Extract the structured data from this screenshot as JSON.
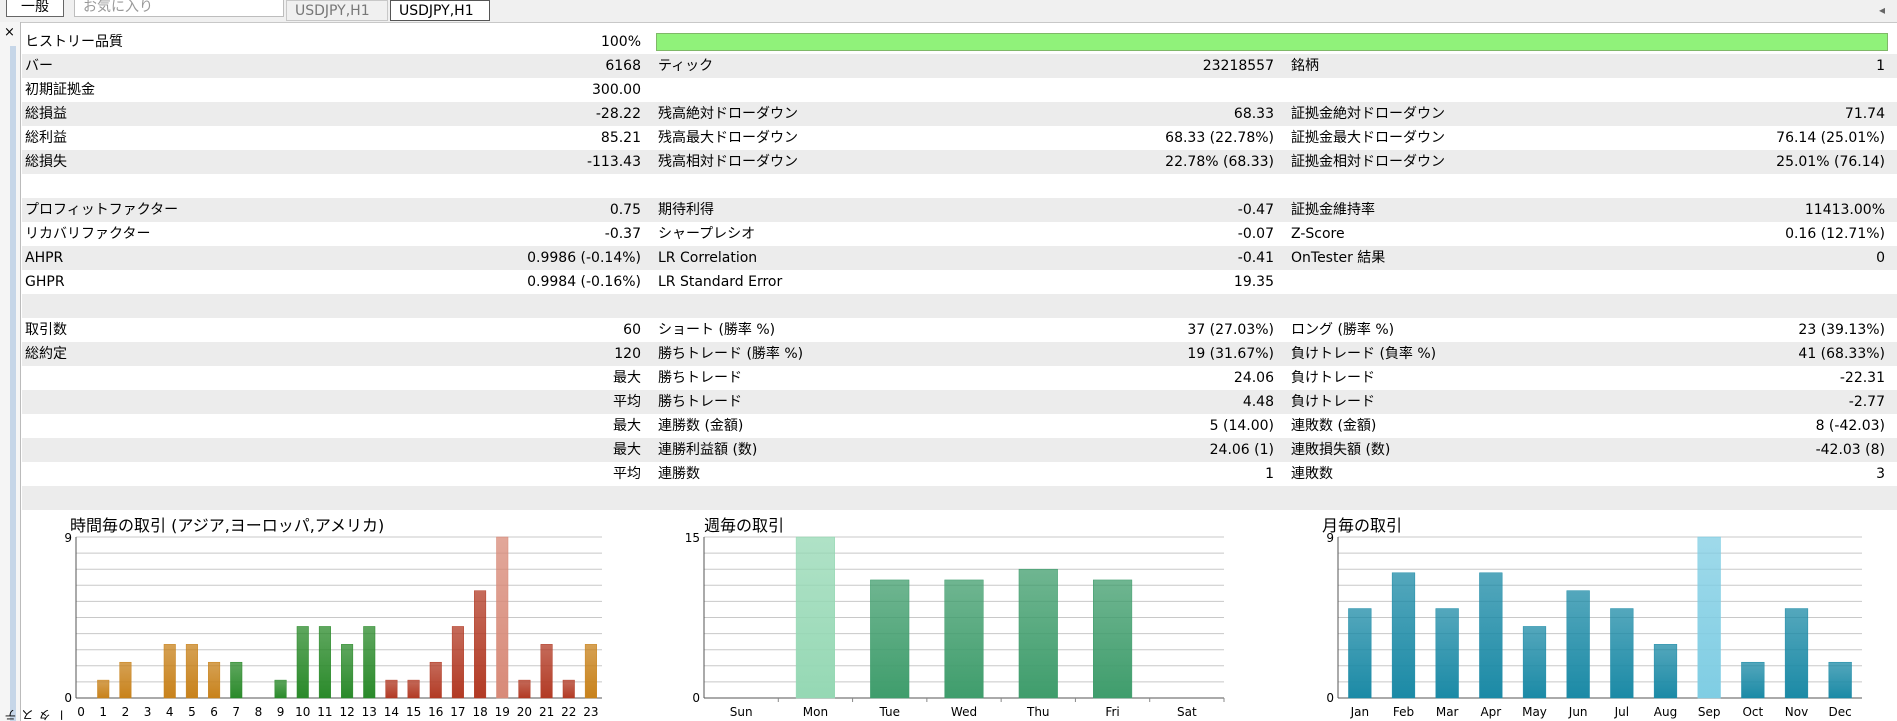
{
  "tabs": {
    "general": "一般",
    "favorites": "お気に入り",
    "chart1": "USDJPY,H1",
    "chart2": "USDJPY,H1"
  },
  "sidebar": {
    "close": "×",
    "label": "テスター"
  },
  "report": {
    "history_quality": {
      "label": "ヒストリー品質",
      "value": "100%",
      "percent": 100
    },
    "bars": {
      "label": "バー",
      "value": "6168"
    },
    "ticks": {
      "label": "ティック",
      "value": "23218557"
    },
    "symbols": {
      "label": "銘柄",
      "value": "1"
    },
    "initial_deposit": {
      "label": "初期証拠金",
      "value": "300.00"
    },
    "net_profit": {
      "label": "総損益",
      "value": "-28.22"
    },
    "balance_abs_dd": {
      "label": "残高絶対ドローダウン",
      "value": "68.33"
    },
    "equity_abs_dd": {
      "label": "証拠金絶対ドローダウン",
      "value": "71.74"
    },
    "gross_profit": {
      "label": "総利益",
      "value": "85.21"
    },
    "balance_max_dd": {
      "label": "残高最大ドローダウン",
      "value": "68.33 (22.78%)"
    },
    "equity_max_dd": {
      "label": "証拠金最大ドローダウン",
      "value": "76.14 (25.01%)"
    },
    "gross_loss": {
      "label": "総損失",
      "value": "-113.43"
    },
    "balance_rel_dd": {
      "label": "残高相対ドローダウン",
      "value": "22.78% (68.33)"
    },
    "equity_rel_dd": {
      "label": "証拠金相対ドローダウン",
      "value": "25.01% (76.14)"
    },
    "profit_factor": {
      "label": "プロフィットファクター",
      "value": "0.75"
    },
    "expected_payoff": {
      "label": "期待利得",
      "value": "-0.47"
    },
    "margin_level": {
      "label": "証拠金維持率",
      "value": "11413.00%"
    },
    "recovery_factor": {
      "label": "リカバリファクター",
      "value": "-0.37"
    },
    "sharpe": {
      "label": "シャープレシオ",
      "value": "-0.07"
    },
    "zscore": {
      "label": "Z-Score",
      "value": "0.16 (12.71%)"
    },
    "ahpr": {
      "label": "AHPR",
      "value": "0.9986 (-0.14%)"
    },
    "lr_corr": {
      "label": "LR Correlation",
      "value": "-0.41"
    },
    "ontester": {
      "label": "OnTester 結果",
      "value": "0"
    },
    "ghpr": {
      "label": "GHPR",
      "value": "0.9984 (-0.16%)"
    },
    "lr_stderr": {
      "label": "LR Standard Error",
      "value": "19.35"
    },
    "total_trades": {
      "label": "取引数",
      "value": "60"
    },
    "short_trades": {
      "label": "ショート (勝率 %)",
      "value": "37 (27.03%)"
    },
    "long_trades": {
      "label": "ロング (勝率 %)",
      "value": "23 (39.13%)"
    },
    "total_deals": {
      "label": "総約定",
      "value": "120"
    },
    "profit_trades": {
      "label": "勝ちトレード (勝率 %)",
      "value": "19 (31.67%)"
    },
    "loss_trades": {
      "label": "負けトレード (負率 %)",
      "value": "41 (68.33%)"
    },
    "largest_profit": {
      "prefix": "最大",
      "label": "勝ちトレード",
      "value": "24.06"
    },
    "largest_loss": {
      "label": "負けトレード",
      "value": "-22.31"
    },
    "average_profit": {
      "prefix": "平均",
      "label": "勝ちトレード",
      "value": "4.48"
    },
    "average_loss": {
      "label": "負けトレード",
      "value": "-2.77"
    },
    "max_cons_wins": {
      "prefix": "最大",
      "label": "連勝数 (金額)",
      "value": "5 (14.00)"
    },
    "max_cons_losses": {
      "label": "連敗数 (金額)",
      "value": "8 (-42.03)"
    },
    "max_cons_profit": {
      "prefix": "最大",
      "label": "連勝利益額 (数)",
      "value": "24.06 (1)"
    },
    "max_cons_loss": {
      "label": "連敗損失額 (数)",
      "value": "-42.03 (8)"
    },
    "avg_cons_wins": {
      "prefix": "平均",
      "label": "連勝数",
      "value": "1"
    },
    "avg_cons_losses": {
      "label": "連敗数",
      "value": "3"
    }
  },
  "chart_data": [
    {
      "type": "bar",
      "title": "時間毎の取引 (アジア,ヨーロッパ,アメリカ)",
      "categories": [
        "0",
        "1",
        "2",
        "3",
        "4",
        "5",
        "6",
        "7",
        "8",
        "9",
        "10",
        "11",
        "12",
        "13",
        "14",
        "15",
        "16",
        "17",
        "18",
        "19",
        "20",
        "21",
        "22",
        "23"
      ],
      "values": [
        0,
        1,
        2,
        0,
        3,
        3,
        2,
        2,
        0,
        1,
        4,
        4,
        3,
        4,
        1,
        1,
        2,
        4,
        6,
        9,
        1,
        3,
        1,
        3
      ],
      "ylim": [
        0,
        9
      ],
      "yticks": [
        "0",
        "9"
      ],
      "colors": [
        "#c8821b",
        "#c8821b",
        "#c8821b",
        "#c8821b",
        "#c8821b",
        "#c8821b",
        "#c8821b",
        "#2a8a2a",
        "#2a8a2a",
        "#2a8a2a",
        "#2a8a2a",
        "#2a8a2a",
        "#2a8a2a",
        "#2a8a2a",
        "#b23a24",
        "#b23a24",
        "#b23a24",
        "#b23a24",
        "#b23a24",
        "#d88a78",
        "#b23a24",
        "#b23a24",
        "#b23a24",
        "#c8821b"
      ]
    },
    {
      "type": "bar",
      "title": "週毎の取引",
      "categories": [
        "Sun",
        "Mon",
        "Tue",
        "Wed",
        "Thu",
        "Fri",
        "Sat"
      ],
      "values": [
        0,
        15,
        11,
        11,
        12,
        11,
        0
      ],
      "ylim": [
        0,
        15
      ],
      "yticks": [
        "0",
        "15"
      ],
      "colors": [
        "#3f9d6c",
        "#95d8b4",
        "#3f9d6c",
        "#3f9d6c",
        "#3f9d6c",
        "#3f9d6c",
        "#3f9d6c"
      ]
    },
    {
      "type": "bar",
      "title": "月毎の取引",
      "categories": [
        "Jan",
        "Feb",
        "Mar",
        "Apr",
        "May",
        "Jun",
        "Jul",
        "Aug",
        "Sep",
        "Oct",
        "Nov",
        "Dec"
      ],
      "values": [
        5,
        7,
        5,
        7,
        4,
        6,
        5,
        3,
        9,
        2,
        5,
        2
      ],
      "ylim": [
        0,
        9
      ],
      "yticks": [
        "0",
        "9"
      ],
      "colors": [
        "#1b8aa6",
        "#1b8aa6",
        "#1b8aa6",
        "#1b8aa6",
        "#1b8aa6",
        "#1b8aa6",
        "#1b8aa6",
        "#1b8aa6",
        "#7fcde3",
        "#1b8aa6",
        "#1b8aa6",
        "#1b8aa6"
      ]
    }
  ]
}
